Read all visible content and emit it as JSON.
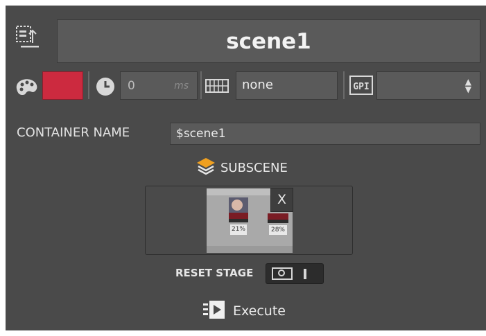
{
  "scene": {
    "title": "scene1"
  },
  "controls": {
    "color": "#cc2a3f",
    "duration_value": "0",
    "duration_unit": "ms",
    "key_value": "none",
    "gpi_value": ""
  },
  "container": {
    "label": "CONTAINER NAME",
    "value": "$scene1"
  },
  "subscene": {
    "label": "SUBSCENE",
    "close_label": "X",
    "thumb_values": [
      "21%",
      "28%"
    ]
  },
  "reset_stage": {
    "label": "RESET STAGE",
    "state": "off"
  },
  "execute": {
    "label": "Execute"
  },
  "icons": {
    "scene": "scene-export-icon",
    "color": "palette-icon",
    "duration": "clock-icon",
    "key": "keyboard-icon",
    "gpi": "gpi-icon",
    "subscene": "layers-icon",
    "execute": "execute-icon"
  },
  "colors": {
    "panel_bg": "#4a4a4a",
    "field_bg": "#5a5a5a",
    "accent_orange": "#f0a020",
    "swatch_red": "#cc2a3f"
  }
}
